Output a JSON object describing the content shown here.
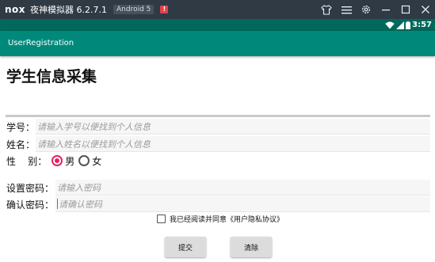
{
  "emulator": {
    "logo": "nox",
    "title": "夜神模拟器 6.2.7.1",
    "android_badge": "Android 5",
    "alert_badge": "!",
    "controls": [
      "shirt-icon",
      "menu-icon",
      "gear-icon",
      "minimize-icon",
      "maximize-icon",
      "close-icon"
    ]
  },
  "status_bar": {
    "time": "3:57",
    "color": "#00695c"
  },
  "action_bar": {
    "title": "UserRegistration",
    "color": "#00897b"
  },
  "form": {
    "title": "学生信息采集",
    "student_id": {
      "label": "学号：",
      "placeholder": "请输入学号以便找到个人信息"
    },
    "name": {
      "label": "姓名：",
      "placeholder": "请输入姓名以便找到个人信息"
    },
    "gender": {
      "label": "性    别：",
      "options": [
        "男",
        "女"
      ],
      "selected": "男"
    },
    "password": {
      "label": "设置密码：",
      "placeholder": "请输入密码"
    },
    "confirm_password": {
      "label": "确认密码：",
      "placeholder": "请确认密码"
    },
    "agreement": {
      "label": "我已经阅读并同意《用户隐私协议》",
      "checked": false
    },
    "submit_label": "提交",
    "clear_label": "清除"
  },
  "colors": {
    "accent": "#e0245e"
  }
}
